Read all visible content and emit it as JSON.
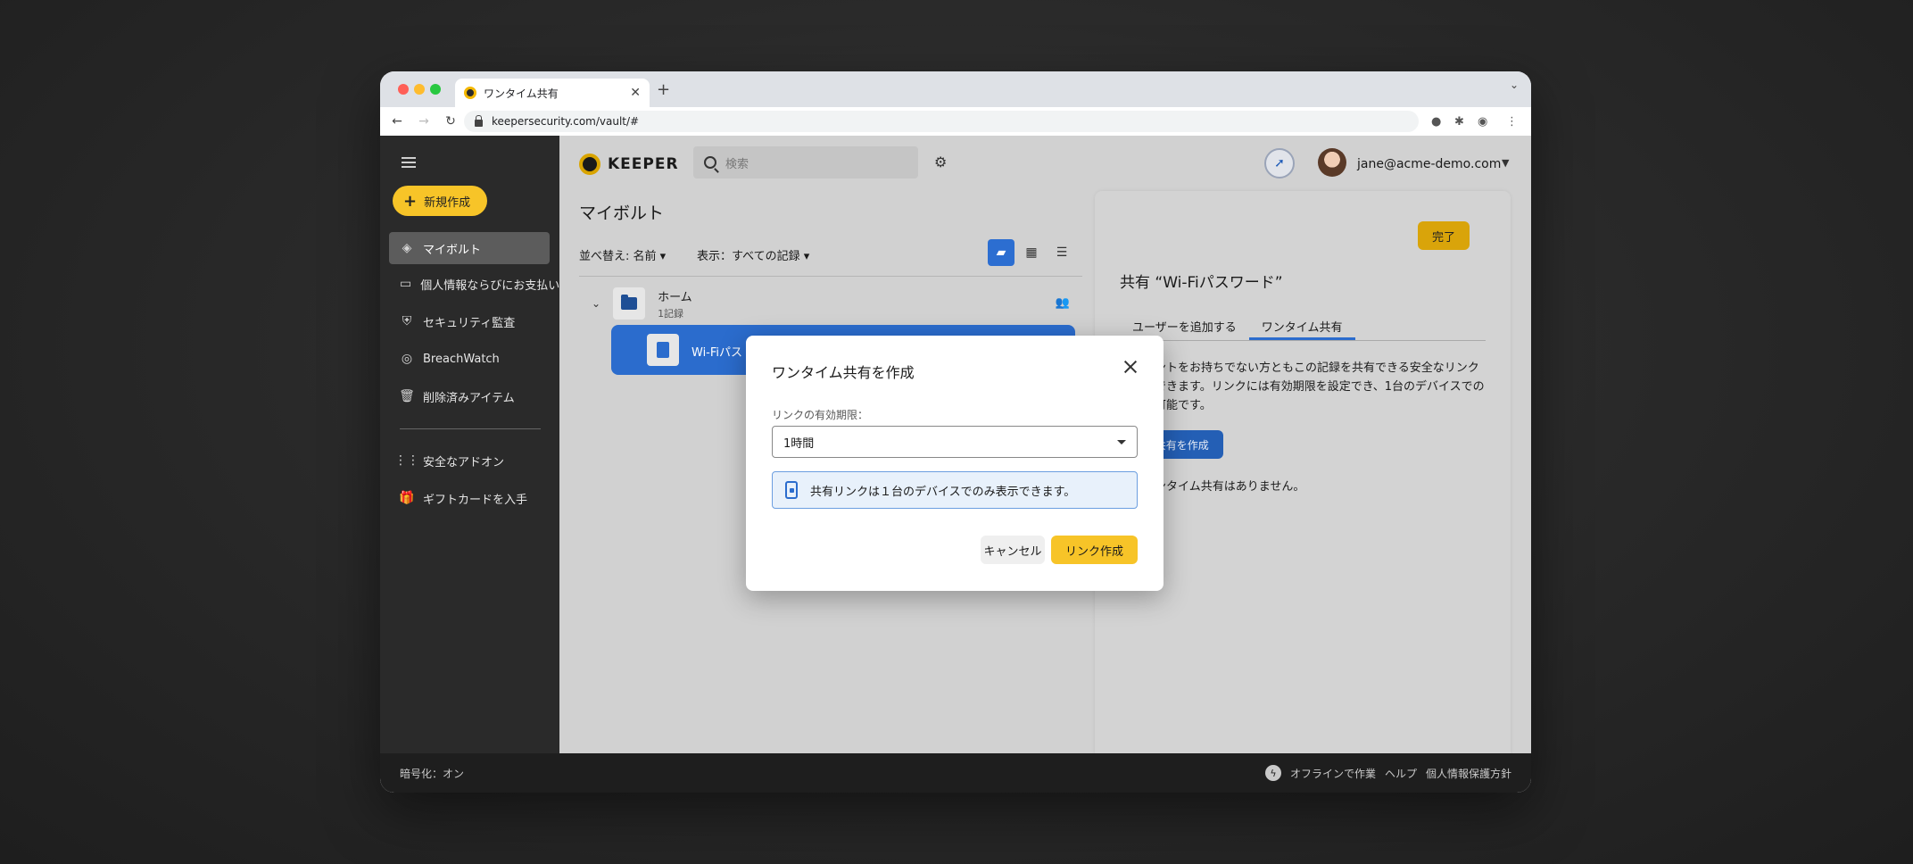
{
  "browser": {
    "tab_title": "ワンタイム共有",
    "url": "keepersecurity.com/vault/#"
  },
  "sidebar": {
    "new_button": "新規作成",
    "items": [
      {
        "label": "マイボルト",
        "icon": "vault-icon",
        "active": true
      },
      {
        "label": "個人情報ならびにお支払い",
        "icon": "card-icon"
      },
      {
        "label": "セキュリティ監査",
        "icon": "shield-icon"
      },
      {
        "label": "BreachWatch",
        "icon": "breachwatch-icon"
      },
      {
        "label": "削除済みアイテム",
        "icon": "trash-icon"
      }
    ],
    "extras": [
      {
        "label": "安全なアドオン",
        "icon": "grid-icon"
      },
      {
        "label": "ギフトカードを入手",
        "icon": "gift-icon"
      }
    ]
  },
  "header": {
    "logo_text": "KEEPER",
    "search_placeholder": "検索",
    "user_email": "jane@acme-demo.com"
  },
  "vault": {
    "title": "マイボルト",
    "sort_label": "並べ替え: 名前",
    "view_label": "表示：すべての記録",
    "folder": {
      "name": "ホーム",
      "count": "1記録"
    },
    "record": {
      "name": "Wi-Fiパス"
    }
  },
  "panel": {
    "done_label": "完了",
    "title": "共有 “Wi-Fiパスワード”",
    "tabs": [
      "ユーザーを追加する",
      "ワンタイム共有"
    ],
    "active_tab": 1,
    "description": "アカウントをお持ちでない方ともこの記録を共有できる安全なリンクを作成できます。リンクには有効期限を設定でき、1台のデバイスでのみ閲覧可能です。",
    "create_button": "イム共有を作成",
    "empty_text": "録のワンタイム共有はありません。"
  },
  "dialog": {
    "title": "ワンタイム共有を作成",
    "expiry_label": "リンクの有効期限：",
    "expiry_value": "1時間",
    "info_text": "共有リンクは１台のデバイスでのみ表示できます。",
    "cancel_label": "キャンセル",
    "create_label": "リンク作成"
  },
  "footer": {
    "encryption": "暗号化：オン",
    "links": [
      "オフラインで作業",
      "ヘルプ",
      "個人情報保護方針"
    ]
  },
  "colors": {
    "accent_yellow": "#f7c428",
    "accent_blue": "#2b6ccd",
    "sidebar_bg": "#2a2a2a"
  }
}
